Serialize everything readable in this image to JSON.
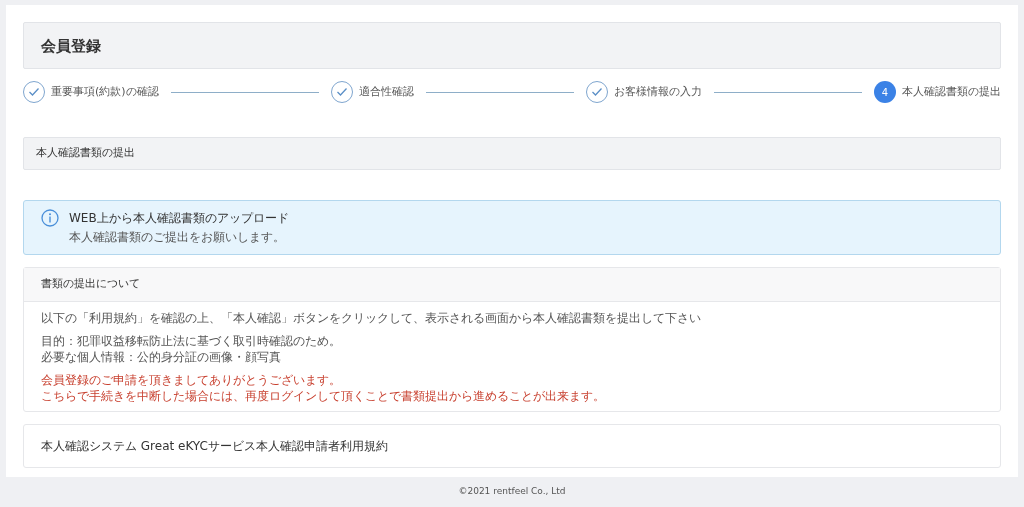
{
  "page_title": "会員登録",
  "steps": [
    {
      "label": "重要事項(約款)の確認",
      "done": true
    },
    {
      "label": "適合性確認",
      "done": true
    },
    {
      "label": "お客様情報の入力",
      "done": true
    },
    {
      "label": "本人確認書類の提出",
      "done": false,
      "number": "4"
    }
  ],
  "section_title": "本人確認書類の提出",
  "info_alert": {
    "title": "WEB上から本人確認書類のアップロード",
    "message": "本人確認書類のご提出をお願いします。"
  },
  "notice_card": {
    "header": "書類の提出について",
    "paragraphs": [
      {
        "kind": "normal",
        "lines": [
          "以下の「利用規約」を確認の上、「本人確認」ボタンをクリックして、表示される画面から本人確認書類を提出して下さい"
        ]
      },
      {
        "kind": "normal",
        "lines": [
          "目的：犯罪収益移転防止法に基づく取引時確認のため。",
          "必要な個人情報：公的身分証の画像・顔写真"
        ]
      },
      {
        "kind": "warning",
        "lines": [
          "会員登録のご申請を頂きましてありがとうございます。",
          "こちらで手続きを中断した場合には、再度ログインして頂くことで書類提出から進めることが出来ます。"
        ]
      }
    ]
  },
  "terms_card": {
    "title": "本人確認システム Great eKYCサービス本人確認申請者利用規約"
  },
  "footer": "©2021 rentfeel Co., Ltd"
}
